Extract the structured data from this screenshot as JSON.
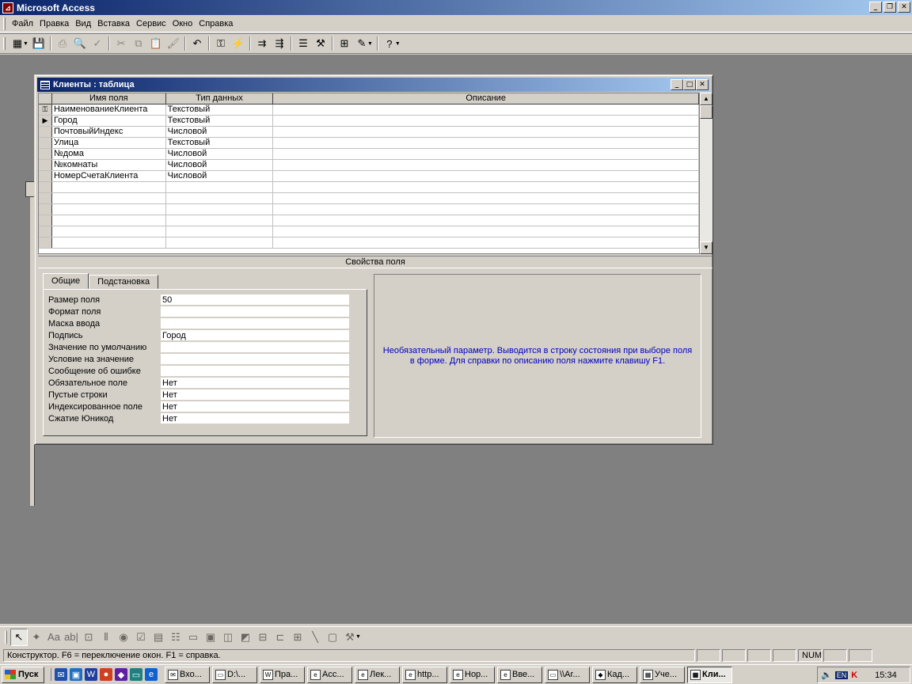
{
  "app": {
    "title": "Microsoft Access"
  },
  "menu": [
    "Файл",
    "Правка",
    "Вид",
    "Вставка",
    "Сервис",
    "Окно",
    "Справка"
  ],
  "toolbar_icons": [
    {
      "name": "view-icon",
      "glyph": "▦",
      "drop": true
    },
    {
      "name": "save-icon",
      "glyph": "💾"
    },
    {
      "name": "print-icon",
      "glyph": "⎙",
      "disabled": true
    },
    {
      "name": "print-preview-icon",
      "glyph": "🔍",
      "disabled": true
    },
    {
      "name": "spelling-icon",
      "glyph": "✓",
      "disabled": true
    },
    {
      "name": "cut-icon",
      "glyph": "✂",
      "disabled": true
    },
    {
      "name": "copy-icon",
      "glyph": "⧉",
      "disabled": true
    },
    {
      "name": "paste-icon",
      "glyph": "📋",
      "disabled": true
    },
    {
      "name": "format-painter-icon",
      "glyph": "🖌",
      "disabled": true
    },
    {
      "name": "undo-icon",
      "glyph": "↶"
    },
    {
      "name": "primary-key-icon",
      "glyph": "⚿"
    },
    {
      "name": "indexes-icon",
      "glyph": "⚡"
    },
    {
      "name": "insert-rows-icon",
      "glyph": "⇉"
    },
    {
      "name": "delete-rows-icon",
      "glyph": "⇶"
    },
    {
      "name": "properties-icon",
      "glyph": "☰"
    },
    {
      "name": "build-icon",
      "glyph": "⚒"
    },
    {
      "name": "database-window-icon",
      "glyph": "⊞"
    },
    {
      "name": "new-object-icon",
      "glyph": "✎",
      "drop": true
    },
    {
      "name": "help-icon",
      "glyph": "?",
      "drop": true
    }
  ],
  "table_window": {
    "title": "Клиенты : таблица",
    "columns": [
      "Имя поля",
      "Тип данных",
      "Описание"
    ],
    "rows": [
      {
        "marker": "key",
        "name": "НаименованиеКлиента",
        "type": "Текстовый",
        "desc": ""
      },
      {
        "marker": "current",
        "name": "Город",
        "type": "Текстовый",
        "desc": ""
      },
      {
        "marker": "",
        "name": "ПочтовыйИндекс",
        "type": "Числовой",
        "desc": ""
      },
      {
        "marker": "",
        "name": "Улица",
        "type": "Текстовый",
        "desc": ""
      },
      {
        "marker": "",
        "name": "№дома",
        "type": "Числовой",
        "desc": ""
      },
      {
        "marker": "",
        "name": "№комнаты",
        "type": "Числовой",
        "desc": ""
      },
      {
        "marker": "",
        "name": "НомерСчетаКлиента",
        "type": "Числовой",
        "desc": ""
      }
    ],
    "empty_rows": 6,
    "field_properties_label": "Свойства поля",
    "tabs": [
      "Общие",
      "Подстановка"
    ],
    "properties": [
      {
        "label": "Размер поля",
        "value": "50"
      },
      {
        "label": "Формат поля",
        "value": ""
      },
      {
        "label": "Маска ввода",
        "value": ""
      },
      {
        "label": "Подпись",
        "value": "Город"
      },
      {
        "label": "Значение по умолчанию",
        "value": ""
      },
      {
        "label": "Условие на значение",
        "value": ""
      },
      {
        "label": "Сообщение об ошибке",
        "value": ""
      },
      {
        "label": "Обязательное поле",
        "value": "Нет"
      },
      {
        "label": "Пустые строки",
        "value": "Нет"
      },
      {
        "label": "Индексированное поле",
        "value": "Нет"
      },
      {
        "label": "Сжатие Юникод",
        "value": "Нет"
      }
    ],
    "help_line1": "Необязательный параметр.  Выводится в строку состояния при выборе поля",
    "help_line2": "в форме.  Для справки по описанию поля нажмите клавишу F1."
  },
  "toolbox_icons": [
    {
      "name": "select-objects-icon",
      "glyph": "↖",
      "active": true
    },
    {
      "name": "control-wizards-icon",
      "glyph": "✦"
    },
    {
      "name": "label-icon",
      "glyph": "Aa"
    },
    {
      "name": "text-box-icon",
      "glyph": "ab|"
    },
    {
      "name": "option-group-icon",
      "glyph": "⊡"
    },
    {
      "name": "toggle-button-icon",
      "glyph": "⫴"
    },
    {
      "name": "option-button-icon",
      "glyph": "◉"
    },
    {
      "name": "check-box-icon",
      "glyph": "☑"
    },
    {
      "name": "combo-box-icon",
      "glyph": "▤"
    },
    {
      "name": "list-box-icon",
      "glyph": "☷"
    },
    {
      "name": "command-button-icon",
      "glyph": "▭"
    },
    {
      "name": "image-icon",
      "glyph": "▣"
    },
    {
      "name": "unbound-object-frame-icon",
      "glyph": "◫"
    },
    {
      "name": "bound-object-frame-icon",
      "glyph": "◩"
    },
    {
      "name": "page-break-icon",
      "glyph": "⊟"
    },
    {
      "name": "tab-control-icon",
      "glyph": "⊏"
    },
    {
      "name": "subform-icon",
      "glyph": "⊞"
    },
    {
      "name": "line-icon",
      "glyph": "╲"
    },
    {
      "name": "rectangle-icon",
      "glyph": "▢"
    },
    {
      "name": "more-controls-icon",
      "glyph": "⚒",
      "drop": true
    }
  ],
  "status": {
    "text": "Конструктор.  F6 = переключение окон.  F1 = справка.",
    "num": "NUM"
  },
  "taskbar": {
    "start": "Пуск",
    "quicklaunch": [
      {
        "name": "outlook-icon",
        "glyph": "✉",
        "color": "#2050b0"
      },
      {
        "name": "desktop-icon",
        "glyph": "▣",
        "color": "#2070c0"
      },
      {
        "name": "word-icon",
        "glyph": "W",
        "color": "#1f3f9f"
      },
      {
        "name": "chrome-icon",
        "glyph": "●",
        "color": "#d04020"
      },
      {
        "name": "app-icon",
        "glyph": "◆",
        "color": "#6020a0"
      },
      {
        "name": "monitor-icon",
        "glyph": "▭",
        "color": "#208080"
      },
      {
        "name": "ie-icon",
        "glyph": "e",
        "color": "#1060d0"
      }
    ],
    "tasks": [
      {
        "label": "Вхо...",
        "icon": "✉"
      },
      {
        "label": "D:\\...",
        "icon": "▭"
      },
      {
        "label": "Пра...",
        "icon": "W"
      },
      {
        "label": "Асс...",
        "icon": "e"
      },
      {
        "label": "Лек...",
        "icon": "e"
      },
      {
        "label": "http...",
        "icon": "e"
      },
      {
        "label": "Нор...",
        "icon": "e"
      },
      {
        "label": "Вве...",
        "icon": "e"
      },
      {
        "label": "\\\\Ar...",
        "icon": "▭"
      },
      {
        "label": "Кад...",
        "icon": "◆"
      },
      {
        "label": "Уче...",
        "icon": "▦"
      },
      {
        "label": "Кли...",
        "icon": "▦",
        "active": true
      }
    ],
    "lang": "EN",
    "clock": "15:34"
  }
}
